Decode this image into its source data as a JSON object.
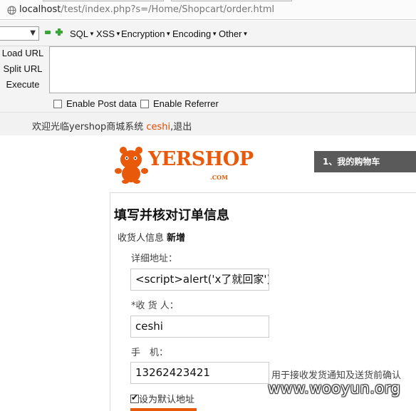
{
  "browser": {
    "url_host": "localhost",
    "url_path": "/test/index.php?s=/Home/Shopcart/order.html"
  },
  "hackbar": {
    "menus": [
      {
        "label": "SQL"
      },
      {
        "label": "XSS"
      },
      {
        "label": "Encryption"
      },
      {
        "label": "Encoding"
      },
      {
        "label": "Other"
      }
    ],
    "buttons": {
      "load": "Load URL",
      "split": "Split URL",
      "execute": "Execute"
    },
    "textarea_value": "",
    "options": {
      "post_data": "Enable Post data",
      "referrer": "Enable Referrer"
    }
  },
  "site": {
    "welcome_prefix": "欢迎光临yershop商城系统 ",
    "username": "ceshi",
    "logout": ",退出",
    "logo_text": "YERSHOP",
    "logo_com": ".COM",
    "step_tab": "1、我的购物车",
    "colors": {
      "brand": "#e85a0a",
      "step_bg": "#5a5a5a"
    }
  },
  "order": {
    "title": "填写并核对订单信息",
    "consignee_label": "收货人信息",
    "consignee_new": "新增",
    "address_label": "详细地址：",
    "address_value": "<script>alert('x了就回家')",
    "receiver_label": "*收 货 人：",
    "receiver_value": "ceshi",
    "phone_label": "手　机：",
    "phone_value": "13262423421",
    "phone_hint": "用于接收发货通知及送货前确认",
    "default_label": "设为默认地址",
    "default_checked": true
  },
  "watermark": "www.wooyun.org"
}
